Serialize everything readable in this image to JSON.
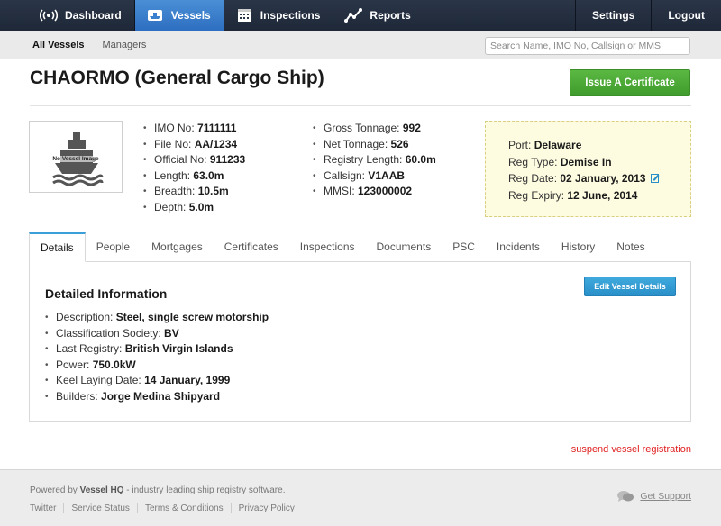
{
  "nav": {
    "items": [
      {
        "label": "Dashboard",
        "icon": "broadcast-icon"
      },
      {
        "label": "Vessels",
        "icon": "ship-icon"
      },
      {
        "label": "Inspections",
        "icon": "calendar-icon"
      },
      {
        "label": "Reports",
        "icon": "chart-line-icon"
      }
    ],
    "settings": "Settings",
    "logout": "Logout",
    "active_color": "#3b7fcf"
  },
  "subnav": {
    "all_vessels": "All Vessels",
    "managers": "Managers",
    "search_placeholder": "Search Name, IMO No, Callsign or MMSI"
  },
  "vessel": {
    "title": "CHAORMO (General Cargo Ship)",
    "issue_label": "Issue A Certificate",
    "image_caption": "No Vessel Image",
    "details_col1": [
      {
        "label": "IMO No: ",
        "value": "7111111"
      },
      {
        "label": "File No: ",
        "value": "AA/1234"
      },
      {
        "label": "Official No: ",
        "value": "911233"
      },
      {
        "label": "Length: ",
        "value": "63.0m"
      },
      {
        "label": "Breadth: ",
        "value": "10.5m"
      },
      {
        "label": "Depth: ",
        "value": "5.0m"
      }
    ],
    "details_col2": [
      {
        "label": "Gross Tonnage: ",
        "value": "992"
      },
      {
        "label": "Net Tonnage: ",
        "value": "526"
      },
      {
        "label": "Registry Length: ",
        "value": "60.0m"
      },
      {
        "label": "Callsign: ",
        "value": "V1AAB"
      },
      {
        "label": "MMSI: ",
        "value": "123000002"
      }
    ],
    "registration": [
      {
        "label": "Port: ",
        "value": "Delaware"
      },
      {
        "label": "Reg Type: ",
        "value": "Demise In"
      },
      {
        "label": "Reg Date: ",
        "value": "02 January, 2013"
      },
      {
        "label": "Reg Expiry: ",
        "value": "12 June, 2014"
      }
    ]
  },
  "tabs": [
    "Details",
    "People",
    "Mortgages",
    "Certificates",
    "Inspections",
    "Documents",
    "PSC",
    "Incidents",
    "History",
    "Notes"
  ],
  "details": {
    "title": "Detailed Information",
    "edit_label": "Edit Vessel Details",
    "items": [
      {
        "label": "Description: ",
        "value": "Steel, single screw motorship"
      },
      {
        "label": "Classification Society: ",
        "value": "BV"
      },
      {
        "label": "Last Registry: ",
        "value": "British Virgin Islands"
      },
      {
        "label": "Power: ",
        "value": "750.0kW"
      },
      {
        "label": "Keel Laying Date: ",
        "value": "14 January, 1999"
      },
      {
        "label": "Builders: ",
        "value": "Jorge Medina Shipyard"
      }
    ]
  },
  "suspend_label": "suspend vessel registration",
  "footer": {
    "powered_prefix": "Powered by ",
    "powered_brand": "Vessel HQ",
    "powered_suffix": " - industry leading ship registry software.",
    "links": [
      "Twitter",
      "Service Status",
      "Terms & Conditions",
      "Privacy Policy"
    ],
    "support": "Get Support"
  }
}
